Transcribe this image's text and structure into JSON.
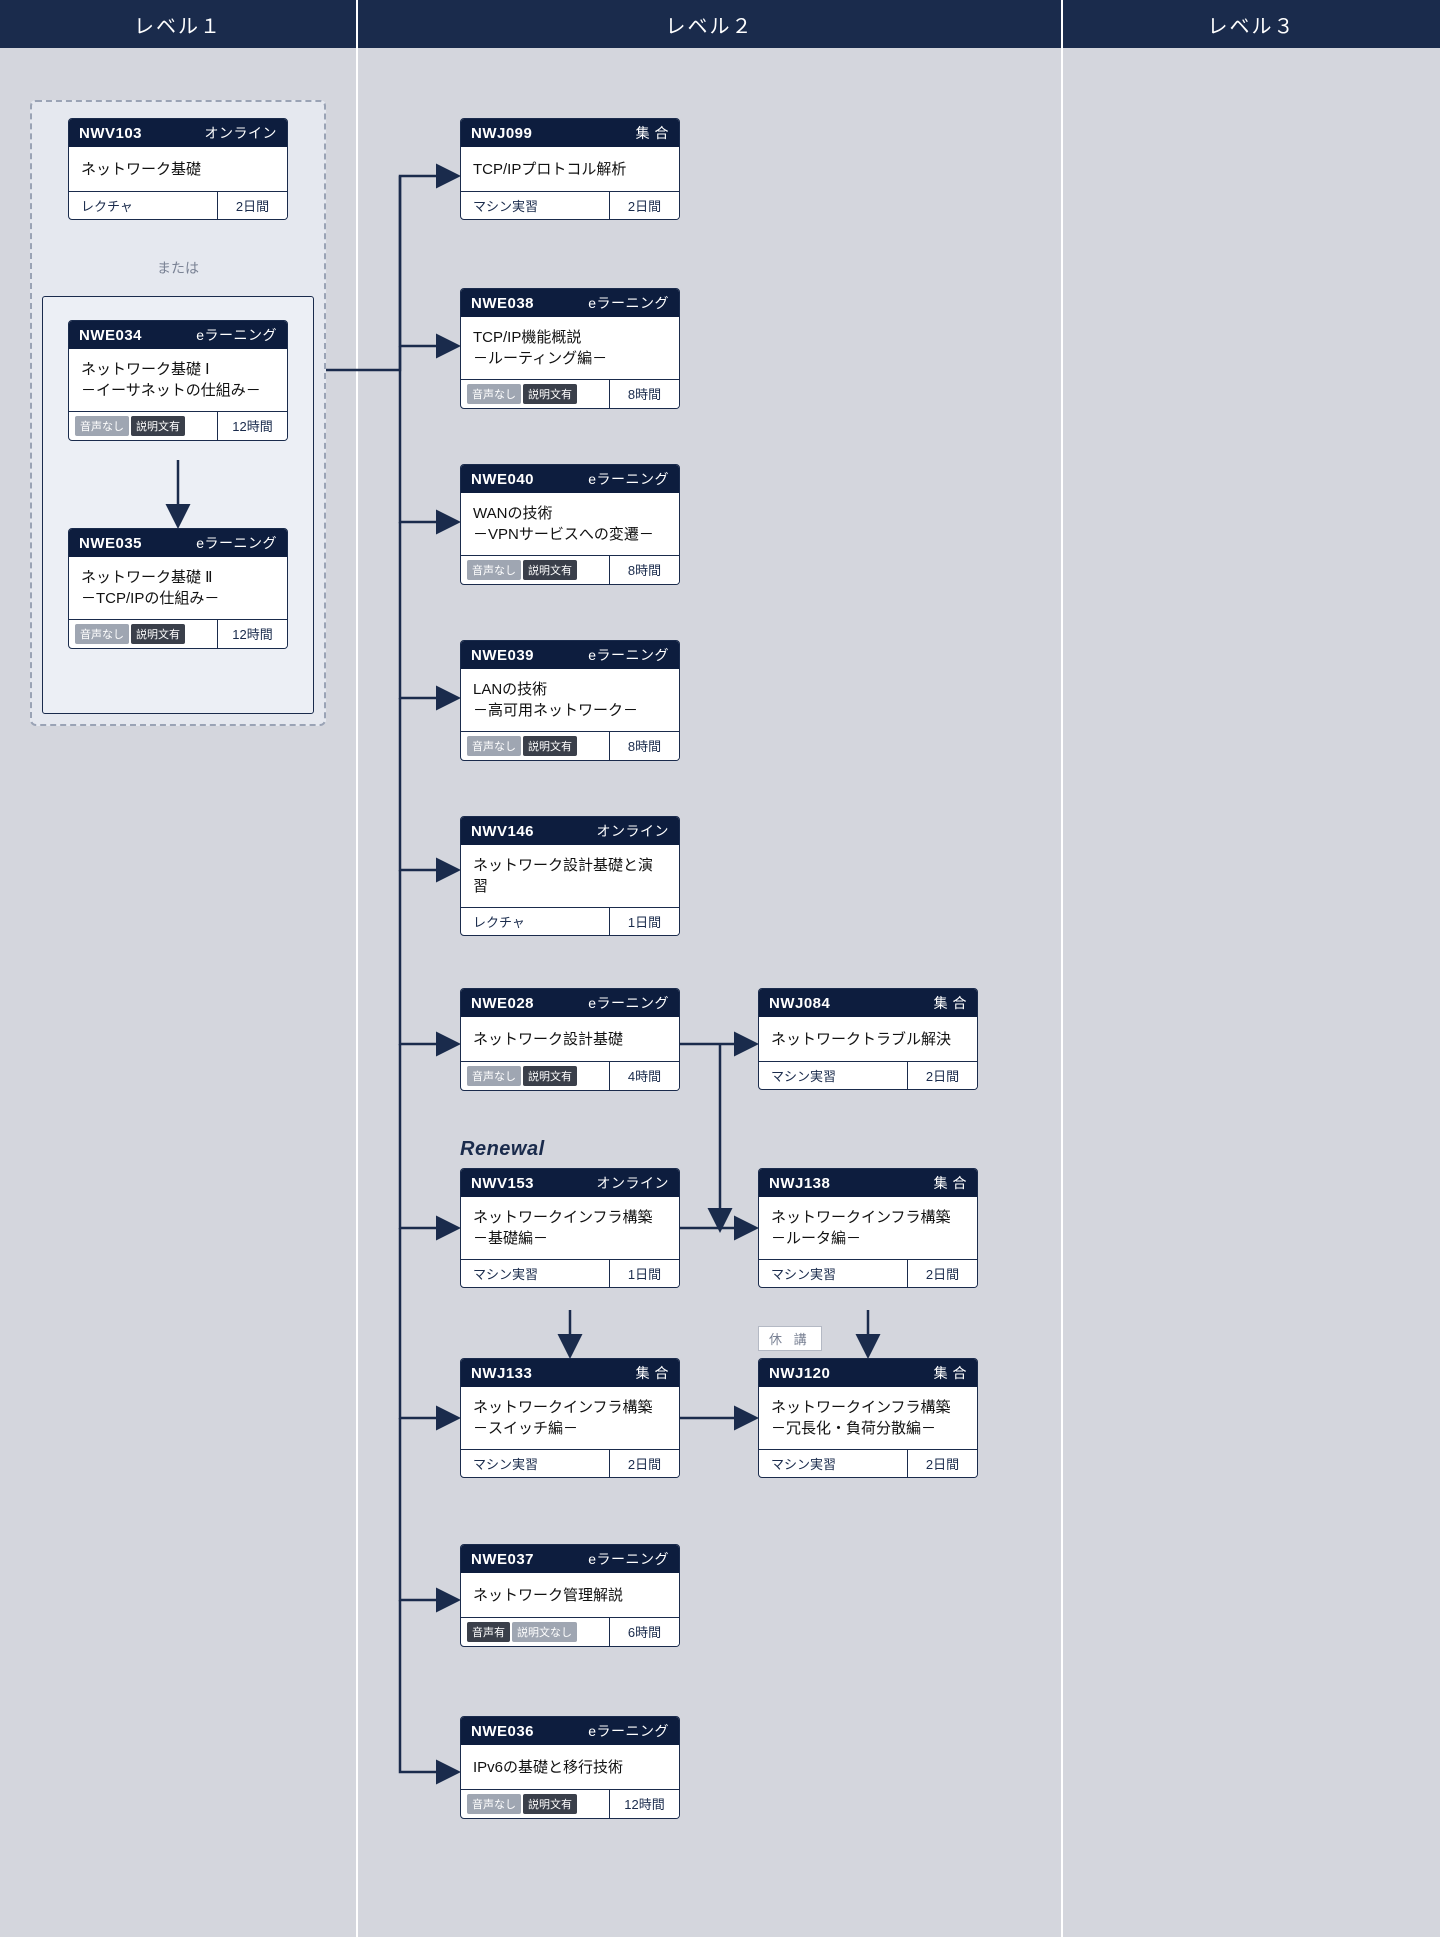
{
  "headers": {
    "l1": "レベル１",
    "l2": "レベル２",
    "l3": "レベル３"
  },
  "labels": {
    "matawa": "または",
    "renewal": "Renewal",
    "suspend": "休 講"
  },
  "tags": {
    "audio_no": "音声なし",
    "audio_yes": "音声有",
    "desc_yes": "説明文有",
    "desc_no": "説明文なし",
    "lecture": "レクチャ",
    "machine": "マシン実習"
  },
  "types": {
    "online": "オンライン",
    "elearn": "eラーニング",
    "group": "集 合"
  },
  "cards": {
    "nwv103": {
      "code": "NWV103",
      "type": "online",
      "title": "ネットワーク基礎",
      "ftr_mode": "lecture",
      "dur": "2日間"
    },
    "nwe034": {
      "code": "NWE034",
      "type": "elearn",
      "title": "ネットワーク基礎 Ⅰ\n－イーサネットの仕組み－",
      "ftr_mode": "audio_no_desc_yes",
      "dur": "12時間"
    },
    "nwe035": {
      "code": "NWE035",
      "type": "elearn",
      "title": "ネットワーク基礎 Ⅱ\n－TCP/IPの仕組み－",
      "ftr_mode": "audio_no_desc_yes",
      "dur": "12時間"
    },
    "nwj099": {
      "code": "NWJ099",
      "type": "group",
      "title": "TCP/IPプロトコル解析",
      "ftr_mode": "machine",
      "dur": "2日間"
    },
    "nwe038": {
      "code": "NWE038",
      "type": "elearn",
      "title": "TCP/IP機能概説\n－ルーティング編－",
      "ftr_mode": "audio_no_desc_yes",
      "dur": "8時間"
    },
    "nwe040": {
      "code": "NWE040",
      "type": "elearn",
      "title": "WANの技術\n－VPNサービスへの変遷－",
      "ftr_mode": "audio_no_desc_yes",
      "dur": "8時間"
    },
    "nwe039": {
      "code": "NWE039",
      "type": "elearn",
      "title": "LANの技術\n－高可用ネットワーク－",
      "ftr_mode": "audio_no_desc_yes",
      "dur": "8時間"
    },
    "nwv146": {
      "code": "NWV146",
      "type": "online",
      "title": "ネットワーク設計基礎と演習",
      "ftr_mode": "lecture",
      "dur": "1日間"
    },
    "nwe028": {
      "code": "NWE028",
      "type": "elearn",
      "title": "ネットワーク設計基礎",
      "ftr_mode": "audio_no_desc_yes",
      "dur": "4時間"
    },
    "nwv153": {
      "code": "NWV153",
      "type": "online",
      "title": "ネットワークインフラ構築\n－基礎編－",
      "ftr_mode": "machine",
      "dur": "1日間"
    },
    "nwj133": {
      "code": "NWJ133",
      "type": "group",
      "title": "ネットワークインフラ構築\n－スイッチ編－",
      "ftr_mode": "machine",
      "dur": "2日間"
    },
    "nwe037": {
      "code": "NWE037",
      "type": "elearn",
      "title": "ネットワーク管理解説",
      "ftr_mode": "audio_yes_desc_no",
      "dur": "6時間"
    },
    "nwe036": {
      "code": "NWE036",
      "type": "elearn",
      "title": "IPv6の基礎と移行技術",
      "ftr_mode": "audio_no_desc_yes",
      "dur": "12時間"
    },
    "nwj084": {
      "code": "NWJ084",
      "type": "group",
      "title": "ネットワークトラブル解決",
      "ftr_mode": "machine",
      "dur": "2日間"
    },
    "nwj138": {
      "code": "NWJ138",
      "type": "group",
      "title": "ネットワークインフラ構築\n－ルータ編－",
      "ftr_mode": "machine",
      "dur": "2日間"
    },
    "nwj120": {
      "code": "NWJ120",
      "type": "group",
      "title": "ネットワークインフラ構築\n－冗長化・負荷分散編－",
      "ftr_mode": "machine",
      "dur": "2日間"
    }
  }
}
